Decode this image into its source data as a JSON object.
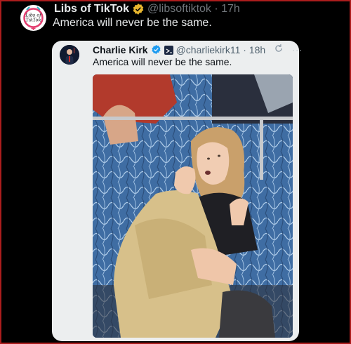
{
  "outer_tweet": {
    "author_name": "Libs of TikTok",
    "handle_time": "@libsoftiktok · 17h",
    "text": "America will never be the same.",
    "avatar_logo_text": "Libs of TikTok"
  },
  "quoted_tweet": {
    "author_name": "Charlie Kirk",
    "handle_time": "@charliekirk11 · 18h",
    "text": "America will never be the same.",
    "media": {
      "description": "photo of a woman sitting on a blue patterned train seat holding her shirt collar",
      "seat_color": "#3f6da3",
      "shirt_color": "#d7c08a"
    }
  },
  "colors": {
    "background": "#000000",
    "border": "#ab1d1d",
    "verified_gold": "#e8b62e",
    "verified_blue": "#1d9bf0",
    "quote_card_bg": "#eceeef"
  },
  "icons": [
    "verified-badge-icon",
    "flag-icon",
    "sync-icon",
    "more-icon"
  ]
}
